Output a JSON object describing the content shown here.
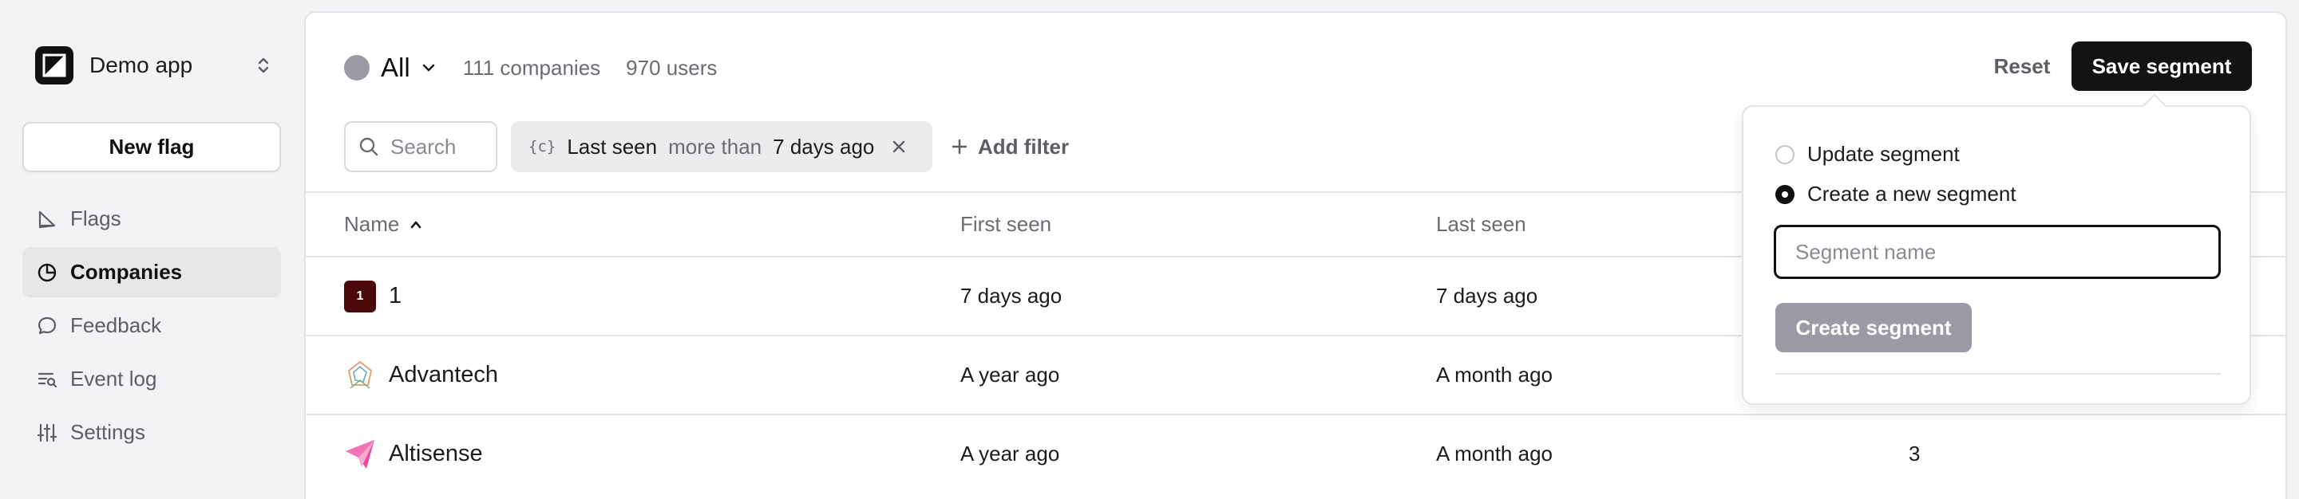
{
  "app": {
    "name": "Demo app",
    "new_flag_label": "New flag"
  },
  "nav": [
    {
      "label": "Flags",
      "icon": "flag-icon",
      "active": false
    },
    {
      "label": "Companies",
      "icon": "pie-chart-icon",
      "active": true
    },
    {
      "label": "Feedback",
      "icon": "chat-bubble-icon",
      "active": false
    },
    {
      "label": "Event log",
      "icon": "event-log-icon",
      "active": false
    },
    {
      "label": "Settings",
      "icon": "sliders-icon",
      "active": false
    }
  ],
  "segment": {
    "name": "All",
    "companies_count": "111 companies",
    "users_count": "970 users",
    "reset_label": "Reset",
    "save_label": "Save segment"
  },
  "search": {
    "placeholder": "Search"
  },
  "filter": {
    "icon_text": "{c}",
    "field": "Last seen",
    "operator": "more than",
    "value": "7 days ago"
  },
  "add_filter_label": "Add filter",
  "table": {
    "columns": [
      "Name",
      "First seen",
      "Last seen"
    ],
    "rows": [
      {
        "name": "1",
        "avatar_text": "1",
        "first_seen": "7 days ago",
        "last_seen": "7 days ago",
        "extra": ""
      },
      {
        "name": "Advantech",
        "avatar_text": "",
        "first_seen": "A year ago",
        "last_seen": "A month ago",
        "extra": ""
      },
      {
        "name": "Altisense",
        "avatar_text": "",
        "first_seen": "A year ago",
        "last_seen": "A month ago",
        "extra": "3"
      }
    ]
  },
  "popover": {
    "option_update": "Update segment",
    "option_create": "Create a new segment",
    "selected": "create",
    "input_placeholder": "Segment name",
    "create_label": "Create segment"
  },
  "colors": {
    "primary": "#131315",
    "disabled_button": "#9b9ba5",
    "segment_dot": "#9a9aa5",
    "muted_text": "#6b6b74"
  }
}
